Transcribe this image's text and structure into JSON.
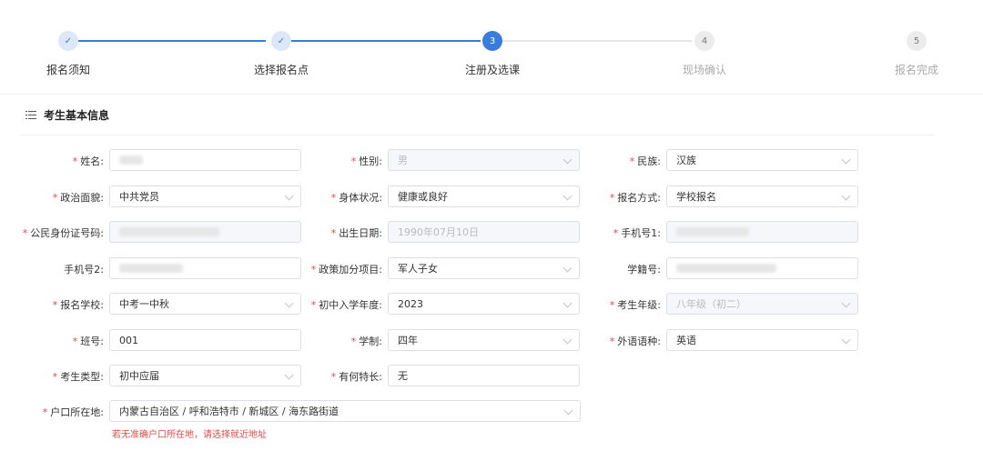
{
  "steps": [
    {
      "label": "报名须知",
      "mark": "✓",
      "state": "done"
    },
    {
      "label": "选择报名点",
      "mark": "✓",
      "state": "done"
    },
    {
      "label": "注册及选课",
      "mark": "3",
      "state": "active"
    },
    {
      "label": "现场确认",
      "mark": "4",
      "state": "todo"
    },
    {
      "label": "报名完成",
      "mark": "5",
      "state": "todo"
    }
  ],
  "section": {
    "title": "考生基本信息",
    "icon": "list-icon"
  },
  "form": {
    "name": {
      "label": "姓名:"
    },
    "gender": {
      "label": "性别:",
      "value": "男"
    },
    "ethnicity": {
      "label": "民族:",
      "value": "汉族"
    },
    "political": {
      "label": "政治面貌:",
      "value": "中共党员"
    },
    "health": {
      "label": "身体状况:",
      "value": "健康或良好"
    },
    "method": {
      "label": "报名方式:",
      "value": "学校报名"
    },
    "idcard": {
      "label": "公民身份证号码:"
    },
    "birth": {
      "label": "出生日期:",
      "value": "1990年07月10日"
    },
    "phone1": {
      "label": "手机号1:"
    },
    "phone2": {
      "label": "手机号2:"
    },
    "bonus": {
      "label": "政策加分项目:",
      "value": "军人子女"
    },
    "studentno": {
      "label": "学籍号:"
    },
    "school": {
      "label": "报名学校:",
      "value": "中考一中秋"
    },
    "entryyear": {
      "label": "初中入学年度:",
      "value": "2023"
    },
    "grade": {
      "label": "考生年级:",
      "value": "八年级（初二）"
    },
    "classno": {
      "label": "班号:",
      "value": "001"
    },
    "system": {
      "label": "学制:",
      "value": "四年"
    },
    "language": {
      "label": "外语语种:",
      "value": "英语"
    },
    "type": {
      "label": "考生类型:",
      "value": "初中应届"
    },
    "talent": {
      "label": "有何特长:",
      "value": "无"
    },
    "hukou": {
      "label": "户口所在地:",
      "value": "内蒙古自治区 / 呼和浩特市 / 新城区 / 海东路街道",
      "hint": "若无准确户口所在地，请选择就近地址"
    }
  }
}
